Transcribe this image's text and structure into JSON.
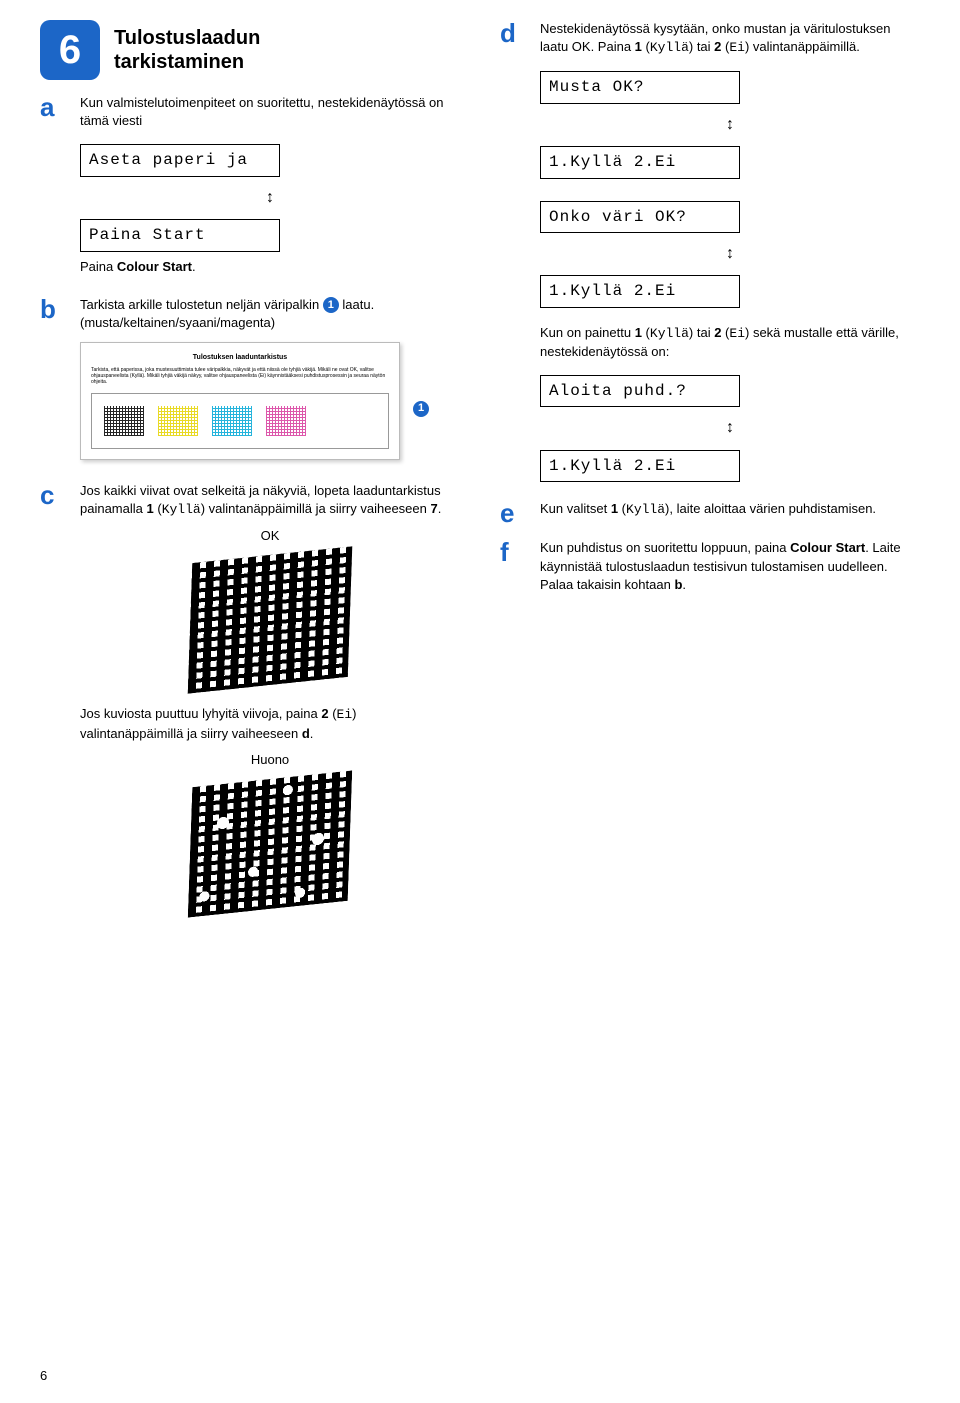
{
  "step": {
    "number": "6",
    "title_line1": "Tulostuslaadun",
    "title_line2": "tarkistaminen"
  },
  "a": {
    "letter": "a",
    "text": "Kun valmistelutoimenpiteet on suoritettu, nestekidenäytössä on tämä viesti",
    "lcd1": "Aseta paperi ja",
    "lcd2": "Paina Start",
    "paina_pre": "Paina ",
    "paina_bold": "Colour Start",
    "paina_post": "."
  },
  "b": {
    "letter": "b",
    "text_pre": "Tarkista arkille tulostetun neljän väripalkin ",
    "callout": "1",
    "text_post": " laatu. (musta/keltainen/syaani/magenta)",
    "sheet_title": "Tulostuksen laaduntarkistus",
    "sheet_body": "Tarkista, että paperissa, joka mustesuuttimista tulee väripalkkia, näkyvät ja että niissä ole tyhjiä väkijä. Mikäli ne ovat OK, valitse ohjauspaneelista (Kyllä). Mikäli tyhjiä väkijä näkyy, valitse ohjauspaneelista (Ei) käynnistääksesi puhdistusprosessin ja seuraa näytön ohjeita."
  },
  "c": {
    "letter": "c",
    "text1_pre": "Jos kaikki viivat ovat selkeitä ja näkyviä, lopeta laaduntarkistus painamalla ",
    "text1_b1": "1",
    "text1_mid1": " (",
    "text1_mono1": "Kyllä",
    "text1_mid2": ") valintanäppäimillä ja siirry vaiheeseen ",
    "text1_b2": "7",
    "text1_post": ".",
    "ok_label": "OK",
    "text2_pre": "Jos kuviosta puuttuu lyhyitä viivoja, paina ",
    "text2_b1": "2",
    "text2_mid1": " (",
    "text2_mono1": "Ei",
    "text2_mid2": ") valintanäppäimillä ja siirry vaiheeseen ",
    "text2_bstep": "d",
    "text2_post": ".",
    "huono_label": "Huono"
  },
  "d": {
    "letter": "d",
    "text_pre": "Nestekidenäytössä kysytään, onko mustan ja väritulostuksen laatu OK. Paina ",
    "d_b1": "1",
    "d_mid1": " (",
    "d_mono1": "Kyllä",
    "d_mid2": ") tai ",
    "d_b2": "2",
    "d_mid3": " (",
    "d_mono2": "Ei",
    "d_post": ") valintanäppäimillä.",
    "lcd_musta": "Musta OK?",
    "lcd_ky1": "1.Kyllä 2.Ei",
    "lcd_vari": "Onko väri OK?",
    "lcd_ky2": "1.Kyllä 2.Ei",
    "after_pre": "Kun on painettu ",
    "after_b1": "1",
    "after_mid1": " (",
    "after_mono1": "Kyllä",
    "after_mid2": ") tai ",
    "after_b2": "2",
    "after_mid3": " (",
    "after_mono2": "Ei",
    "after_post": ") sekä mustalle että värille, nestekidenäytössä on:",
    "lcd_puhd": "Aloita puhd.?",
    "lcd_ky3": "1.Kyllä 2.Ei"
  },
  "e": {
    "letter": "e",
    "text_pre": "Kun valitset ",
    "e_b1": "1",
    "e_mid1": " (",
    "e_mono1": "Kyllä",
    "e_post": "), laite aloittaa värien puhdistamisen."
  },
  "f": {
    "letter": "f",
    "text_pre": "Kun puhdistus on suoritettu loppuun, paina ",
    "f_bold": "Colour Start",
    "f_mid": ". Laite käynnistää tulostuslaadun testisivun tulostamisen uudelleen. Palaa takaisin kohtaan ",
    "f_bstep": "b",
    "f_post": "."
  },
  "updown": "↕",
  "page": "6"
}
